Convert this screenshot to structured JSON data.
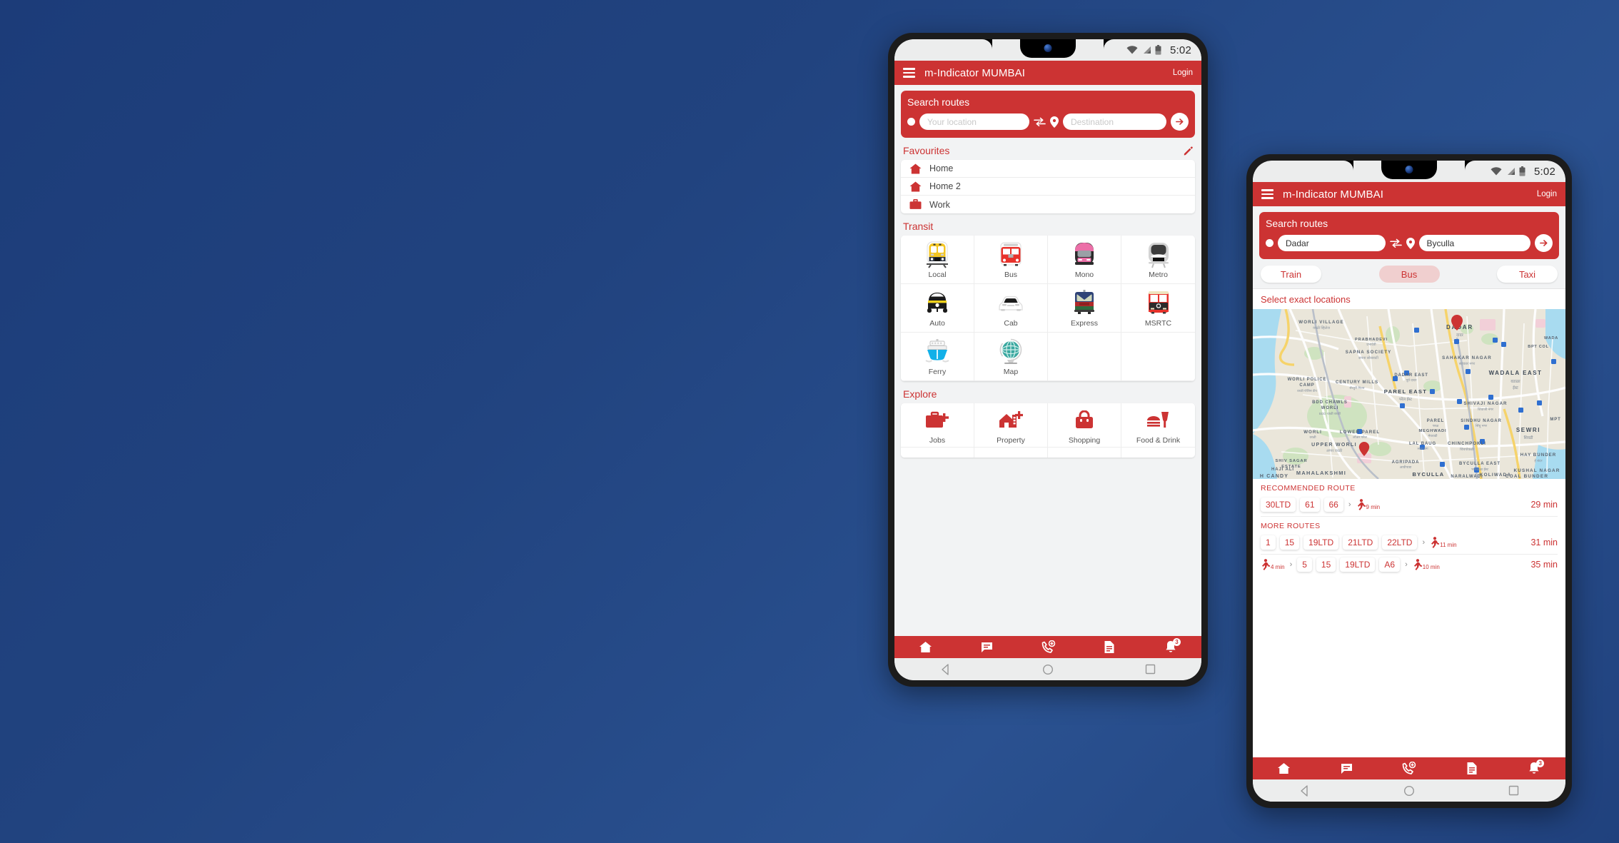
{
  "background": {
    "color_top": "#1c3c79",
    "color_bottom": "#2a5190"
  },
  "brand": {
    "red": "#cc3333",
    "accent_light": "#f0cfcf"
  },
  "phone1": {
    "statusbar": {
      "time": "5:02",
      "icons": [
        "wifi-icon",
        "signal-icon",
        "battery-icon"
      ]
    },
    "appbar": {
      "menu_icon": "hamburger-icon",
      "title": "m-Indicator MUMBAI",
      "login_label": "Login"
    },
    "search": {
      "title": "Search routes",
      "origin_value": "",
      "origin_placeholder": "Your location",
      "destination_value": "",
      "destination_placeholder": "Destination",
      "swap_icon": "swap-arrows-icon",
      "pin_icon": "map-pin-icon",
      "go_icon": "arrow-right-icon"
    },
    "favourites": {
      "title": "Favourites",
      "edit_icon": "pencil-icon",
      "items": [
        {
          "label": "Home",
          "icon": "home-icon"
        },
        {
          "label": "Home 2",
          "icon": "home-icon"
        },
        {
          "label": "Work",
          "icon": "briefcase-icon"
        }
      ]
    },
    "transit": {
      "title": "Transit",
      "items": [
        {
          "label": "Local",
          "icon": "local-train-icon"
        },
        {
          "label": "Bus",
          "icon": "bus-icon"
        },
        {
          "label": "Mono",
          "icon": "monorail-icon"
        },
        {
          "label": "Metro",
          "icon": "metro-icon"
        },
        {
          "label": "Auto",
          "icon": "auto-rickshaw-icon"
        },
        {
          "label": "Cab",
          "icon": "cab-icon"
        },
        {
          "label": "Express",
          "icon": "express-train-icon"
        },
        {
          "label": "MSRTC",
          "icon": "msrtc-bus-icon"
        },
        {
          "label": "Ferry",
          "icon": "ferry-icon"
        },
        {
          "label": "Map",
          "icon": "globe-map-icon"
        },
        {
          "label": "",
          "icon": ""
        },
        {
          "label": "",
          "icon": ""
        }
      ]
    },
    "explore": {
      "title": "Explore",
      "items": [
        {
          "label": "Jobs",
          "icon": "jobs-briefcase-plus-icon"
        },
        {
          "label": "Property",
          "icon": "property-house-plus-icon"
        },
        {
          "label": "Shopping",
          "icon": "shopping-bag-icon"
        },
        {
          "label": "Food & Drink",
          "icon": "food-drink-icon"
        }
      ]
    },
    "bottomnav": {
      "items": [
        {
          "icon": "home-icon",
          "badge": ""
        },
        {
          "icon": "chat-icon",
          "badge": ""
        },
        {
          "icon": "call-add-icon",
          "badge": ""
        },
        {
          "icon": "document-icon",
          "badge": ""
        },
        {
          "icon": "bell-icon",
          "badge": "3"
        }
      ]
    },
    "androidnav": {
      "back": "back-triangle-icon",
      "home": "home-circle-icon",
      "recent": "recents-square-icon"
    }
  },
  "phone2": {
    "statusbar": {
      "time": "5:02",
      "icons": [
        "wifi-icon",
        "signal-icon",
        "battery-icon"
      ]
    },
    "appbar": {
      "menu_icon": "hamburger-icon",
      "title": "m-Indicator MUMBAI",
      "login_label": "Login"
    },
    "search": {
      "title": "Search routes",
      "origin_value": "Dadar",
      "origin_placeholder": "Your location",
      "destination_value": "Byculla",
      "destination_placeholder": "Destination",
      "swap_icon": "swap-arrows-icon",
      "pin_icon": "map-pin-icon",
      "go_icon": "arrow-right-icon"
    },
    "modes": [
      {
        "label": "Train",
        "active": false
      },
      {
        "label": "Bus",
        "active": true
      },
      {
        "label": "Taxi",
        "active": false
      }
    ],
    "select_exact_label": "Select exact locations",
    "map": {
      "origin_marker": "map-pin-marker",
      "destination_marker": "map-pin-marker",
      "labels": [
        "WORLI VILLAGE",
        "वरळी व्हिलेज",
        "PRABHADEVI",
        "प्रभादेवी",
        "SAPNA SOCIETY",
        "सपना सोसायटी",
        "WORLI POLICE CAMP",
        "वरळी पोलिस कॅंप",
        "CENTURY MILLS",
        "सेंच्युरी मिल्स",
        "BDD CHAWLS WORLI",
        "BDD चाळी वरळी",
        "WORLI",
        "वरळी",
        "LOWER PAREL",
        "लोअर परेल",
        "UPPER WORLI",
        "अप्पर वरळी",
        "SHIV SAGAR ESTATE",
        "MAHALAKSHMI",
        "महालक्ष्मी",
        "HAJI ALI",
        "H CANDY",
        "AGRIPADA",
        "आग्रीपाडा",
        "BYCULLA",
        "भायखळा",
        "CHINCHPOKLI",
        "चिंचपोकळी",
        "DADAR",
        "दादर",
        "DADAR EAST",
        "पूर्व दादर",
        "SAHAKAR NAGAR",
        "सहकार नगर",
        "WADALA EAST",
        "वडाळा ईस्ट",
        "BPT COLONY",
        "SHIVAJI NAGAR",
        "शिवाजी नगर",
        "PAREL EAST",
        "परेल ईस्ट",
        "PAREL",
        "परळ",
        "SINDHU NAGAR",
        "सिंधु नगर",
        "MEGHWADI",
        "मेघवाडी",
        "LAL BAUG",
        "लाल बाग",
        "SEWRI",
        "शिवडी",
        "MPT",
        "HAY BUNDER",
        "हे बंदर",
        "KOLIWADA",
        "कोळीवाडा",
        "KUSHAL NAGAR",
        "COAL BUNDER",
        "कोल बंदर",
        "NARALWADI",
        "BYCULLA EAST",
        "भायखळा ईस्ट"
      ]
    },
    "routes": {
      "recommended_label": "RECOMMENDED ROUTE",
      "more_label": "MORE ROUTES",
      "recommended": [
        {
          "lead_walk": null,
          "chips": [
            "30LTD",
            "61",
            "66"
          ],
          "trail_walk": "9 min",
          "total": "29 min"
        }
      ],
      "more": [
        {
          "lead_walk": null,
          "chips": [
            "1",
            "15",
            "19LTD",
            "21LTD",
            "22LTD"
          ],
          "trail_walk": "11 min",
          "total": "31 min"
        },
        {
          "lead_walk": "4 min",
          "chips": [
            "5",
            "15",
            "19LTD",
            "A6"
          ],
          "trail_walk": "10 min",
          "total": "35 min"
        }
      ]
    },
    "bottomnav": {
      "items": [
        {
          "icon": "home-icon",
          "badge": ""
        },
        {
          "icon": "chat-icon",
          "badge": ""
        },
        {
          "icon": "call-add-icon",
          "badge": ""
        },
        {
          "icon": "document-icon",
          "badge": ""
        },
        {
          "icon": "bell-icon",
          "badge": "3"
        }
      ]
    },
    "androidnav": {
      "back": "back-triangle-icon",
      "home": "home-circle-icon",
      "recent": "recents-square-icon"
    }
  }
}
